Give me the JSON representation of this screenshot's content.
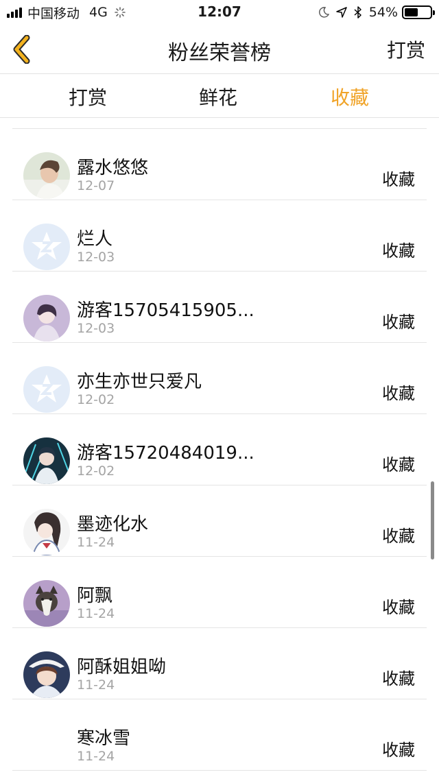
{
  "status_bar": {
    "carrier": "中国移动",
    "network": "4G",
    "time": "12:07",
    "battery": "54%",
    "battery_level": 0.54,
    "icons": [
      "signal-icon",
      "loading-spinner-icon",
      "moon-icon",
      "location-arrow-icon",
      "bluetooth-icon",
      "battery-icon"
    ]
  },
  "nav": {
    "back_icon": "chevron-left-icon",
    "title": "粉丝荣誉榜",
    "right_action": "打赏",
    "accent_color": "#f0a327"
  },
  "tabs": [
    {
      "label": "打赏",
      "active": false
    },
    {
      "label": "鲜花",
      "active": false
    },
    {
      "label": "收藏",
      "active": true
    }
  ],
  "fans": [
    {
      "name": "露水悠悠",
      "date": "12-07",
      "action": "收藏",
      "avatar": "photo-girl"
    },
    {
      "name": "烂人",
      "date": "12-03",
      "action": "收藏",
      "avatar": "default-star"
    },
    {
      "name": "游客15705415905...",
      "date": "12-03",
      "action": "收藏",
      "avatar": "anime-purple"
    },
    {
      "name": "亦生亦世只爱凡",
      "date": "12-02",
      "action": "收藏",
      "avatar": "default-star"
    },
    {
      "name": "游客15720484019...",
      "date": "12-02",
      "action": "收藏",
      "avatar": "anime-blue"
    },
    {
      "name": "墨迹化水",
      "date": "11-24",
      "action": "收藏",
      "avatar": "anime-sailor"
    },
    {
      "name": "阿飘",
      "date": "11-24",
      "action": "收藏",
      "avatar": "husky-dog"
    },
    {
      "name": "阿酥姐姐呦",
      "date": "11-24",
      "action": "收藏",
      "avatar": "anime-hat"
    },
    {
      "name": "寒冰雪",
      "date": "11-24",
      "action": "收藏",
      "avatar": "blank"
    }
  ]
}
